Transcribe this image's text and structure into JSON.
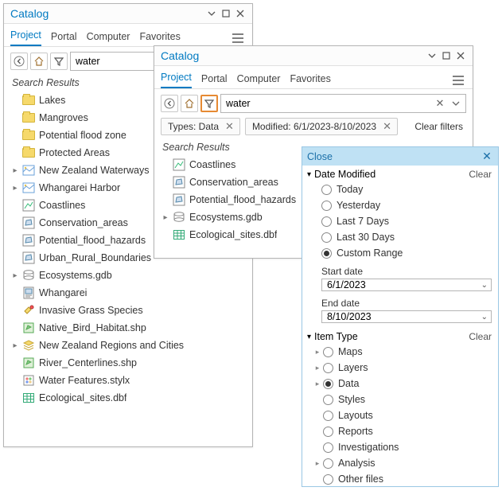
{
  "pane1": {
    "title": "Catalog",
    "tabs": [
      "Project",
      "Portal",
      "Computer",
      "Favorites"
    ],
    "active_tab": 0,
    "search_value": "water",
    "results_header": "Search Results",
    "items": [
      {
        "icon": "folder",
        "label": "Lakes"
      },
      {
        "icon": "folder",
        "label": "Mangroves"
      },
      {
        "icon": "folder",
        "label": "Potential flood zone"
      },
      {
        "icon": "folder",
        "label": "Protected Areas"
      },
      {
        "icon": "map",
        "label": "New Zealand Waterways",
        "expand": true
      },
      {
        "icon": "map",
        "label": "Whangarei Harbor",
        "expand": true
      },
      {
        "icon": "line-fc",
        "label": "Coastlines"
      },
      {
        "icon": "poly-fc",
        "label": "Conservation_areas"
      },
      {
        "icon": "poly-fc",
        "label": "Potential_flood_hazards"
      },
      {
        "icon": "poly-fc",
        "label": "Urban_Rural_Boundaries"
      },
      {
        "icon": "gdb",
        "label": "Ecosystems.gdb",
        "expand": true
      },
      {
        "icon": "layout",
        "label": "Whangarei"
      },
      {
        "icon": "tool",
        "label": "Invasive Grass Species"
      },
      {
        "icon": "shp",
        "label": "Native_Bird_Habitat.shp"
      },
      {
        "icon": "layers",
        "label": "New Zealand Regions and Cities",
        "expand": true
      },
      {
        "icon": "shp",
        "label": "River_Centerlines.shp"
      },
      {
        "icon": "style",
        "label": "Water Features.stylx"
      },
      {
        "icon": "table",
        "label": "Ecological_sites.dbf"
      }
    ]
  },
  "pane2": {
    "title": "Catalog",
    "tabs": [
      "Project",
      "Portal",
      "Computer",
      "Favorites"
    ],
    "active_tab": 0,
    "search_value": "water",
    "chips": [
      {
        "label": "Types: Data"
      },
      {
        "label": "Modified: 6/1/2023‑8/10/2023"
      }
    ],
    "clear_filters_label": "Clear filters",
    "results_header": "Search Results",
    "items": [
      {
        "icon": "line-fc",
        "label": "Coastlines"
      },
      {
        "icon": "poly-fc",
        "label": "Conservation_areas"
      },
      {
        "icon": "poly-fc",
        "label": "Potential_flood_hazards"
      },
      {
        "icon": "gdb",
        "label": "Ecosystems.gdb",
        "expand": true
      },
      {
        "icon": "table",
        "label": "Ecological_sites.dbf"
      }
    ]
  },
  "popup": {
    "close_label": "Close",
    "groups": {
      "date": {
        "title": "Date Modified",
        "clear": "Clear",
        "options": [
          "Today",
          "Yesterday",
          "Last 7 Days",
          "Last 30 Days",
          "Custom Range"
        ],
        "selected": 4,
        "start_label": "Start date",
        "start_value": "6/1/2023",
        "end_label": "End date",
        "end_value": "8/10/2023"
      },
      "type": {
        "title": "Item Type",
        "clear": "Clear",
        "options": [
          {
            "label": "Maps",
            "expand": true
          },
          {
            "label": "Layers",
            "expand": true
          },
          {
            "label": "Data",
            "expand": true,
            "selected": true
          },
          {
            "label": "Styles"
          },
          {
            "label": "Layouts"
          },
          {
            "label": "Reports"
          },
          {
            "label": "Investigations"
          },
          {
            "label": "Analysis",
            "expand": true
          },
          {
            "label": "Other files"
          }
        ]
      }
    }
  }
}
